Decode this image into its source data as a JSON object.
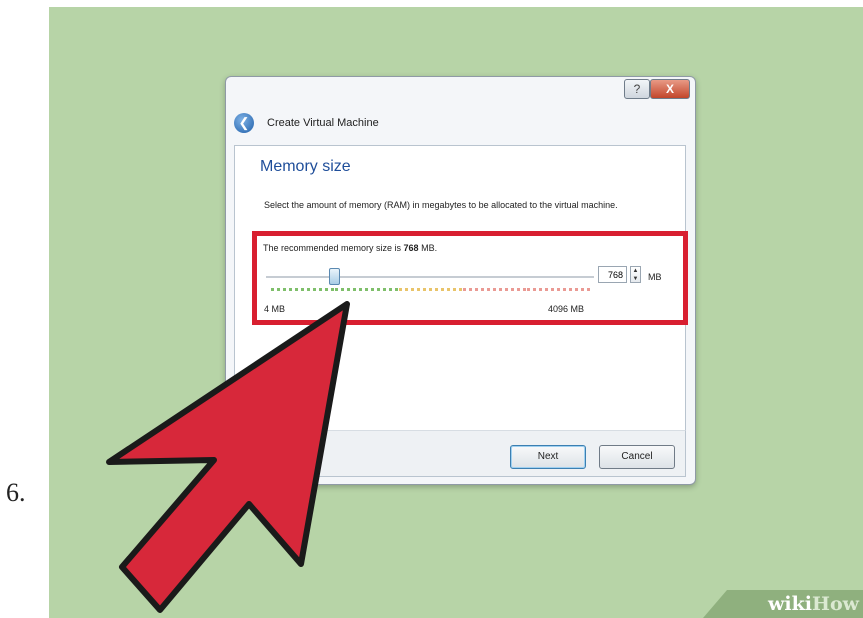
{
  "step_number": "6.",
  "dialog": {
    "help_button": "?",
    "close_button": "X",
    "back_icon": "back-arrow-icon",
    "title": "Create Virtual Machine",
    "heading": "Memory size",
    "description": "Select the amount of memory (RAM) in megabytes to be allocated to the virtual machine.",
    "recommended_prefix": "The recommended memory size is ",
    "recommended_value": "768",
    "recommended_suffix": " MB.",
    "memory_value": "768",
    "memory_unit": "MB",
    "slider_min_label": "4 MB",
    "slider_max_label": "4096 MB",
    "slider_value_mb": 768,
    "next_button": "Next",
    "cancel_button": "Cancel"
  },
  "highlight_color": "#d81f30",
  "arrow_color": "#d7283a",
  "background_color": "#b7d4a7",
  "watermark": {
    "prefix": "wiki",
    "suffix": "How"
  }
}
